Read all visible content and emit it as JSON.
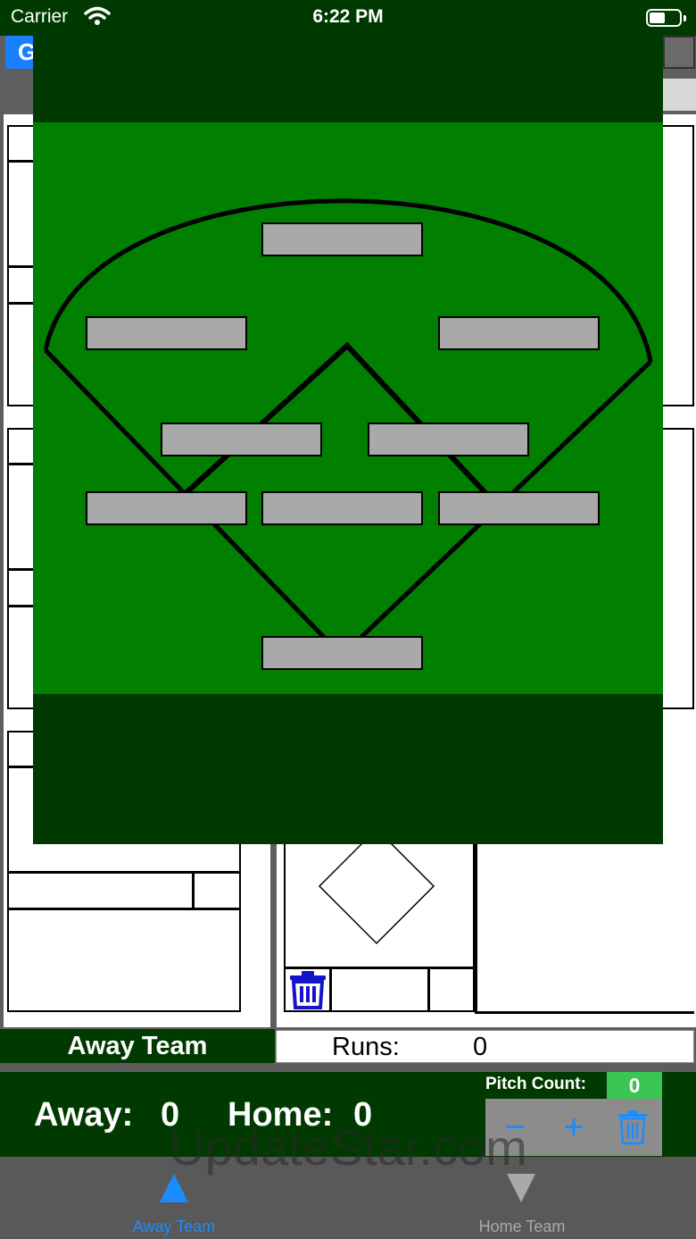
{
  "status_bar": {
    "carrier": "Carrier",
    "time": "6:22 PM"
  },
  "header": {
    "left_button_fragment": "G"
  },
  "current_team": {
    "label": "Away Team",
    "runs_label": "Runs:",
    "runs_value": "0"
  },
  "scoreboard": {
    "away_label": "Away:",
    "away_score": "0",
    "home_label": "Home:",
    "home_score": "0"
  },
  "pitch_count": {
    "label": "Pitch Count:",
    "value": "0",
    "decrement_symbol": "−",
    "increment_symbol": "+"
  },
  "watermark": "UpdateStar.com",
  "tabs": [
    {
      "label": "Away Team",
      "selected": true
    },
    {
      "label": "Home Team",
      "selected": false
    }
  ],
  "colors": {
    "dark_green": "#003a00",
    "field_green": "#007f00",
    "accent_blue": "#1a8cff",
    "pitch_count_green": "#3bc555"
  }
}
